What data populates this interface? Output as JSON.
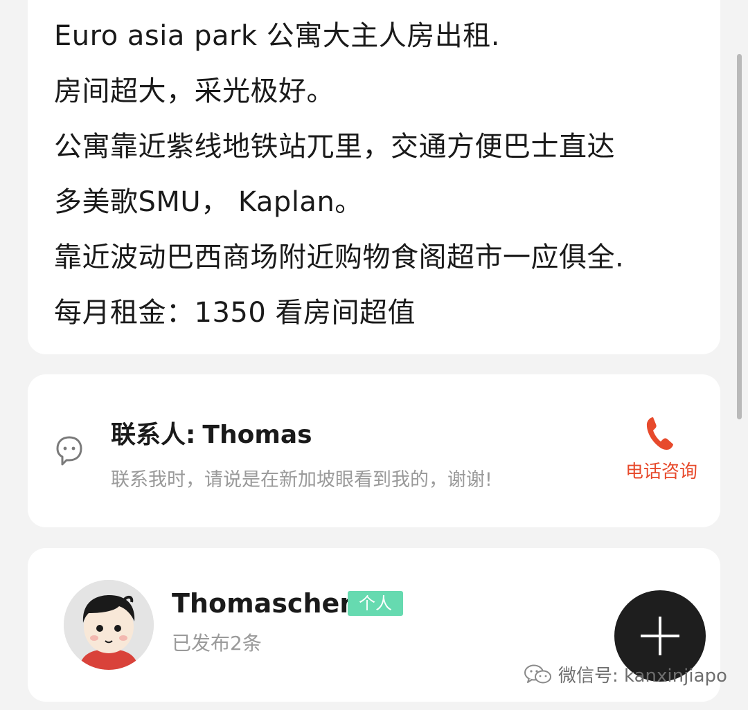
{
  "listing": {
    "description_lines": [
      "Euro asia park 公寓大主人房出租.",
      "房间超大，采光极好。",
      "公寓靠近紫线地铁站兀里，交通方便巴士直达",
      "多美歌SMU， Kaplan。",
      "靠近波动巴西商场附近购物食阁超市一应俱全.",
      "每月租金：1350 看房间超值"
    ]
  },
  "contact": {
    "label": "联系人:",
    "name": "Thomas",
    "hint": "联系我时，请说是在新加坡眼看到我的，谢谢!",
    "phone_label": "电话咨询",
    "phone_color": "#e74a2c",
    "icon": "chat-bubble-icon"
  },
  "poster": {
    "name": "Thomaschen",
    "badge": "个人",
    "badge_color": "#66dab0",
    "post_count": "已发布2条",
    "avatar": "cartoon-avatar"
  },
  "fab": {
    "icon": "plus-icon"
  },
  "watermark": {
    "text": "微信号: kanxinjiapo",
    "icon": "wechat-icon"
  }
}
